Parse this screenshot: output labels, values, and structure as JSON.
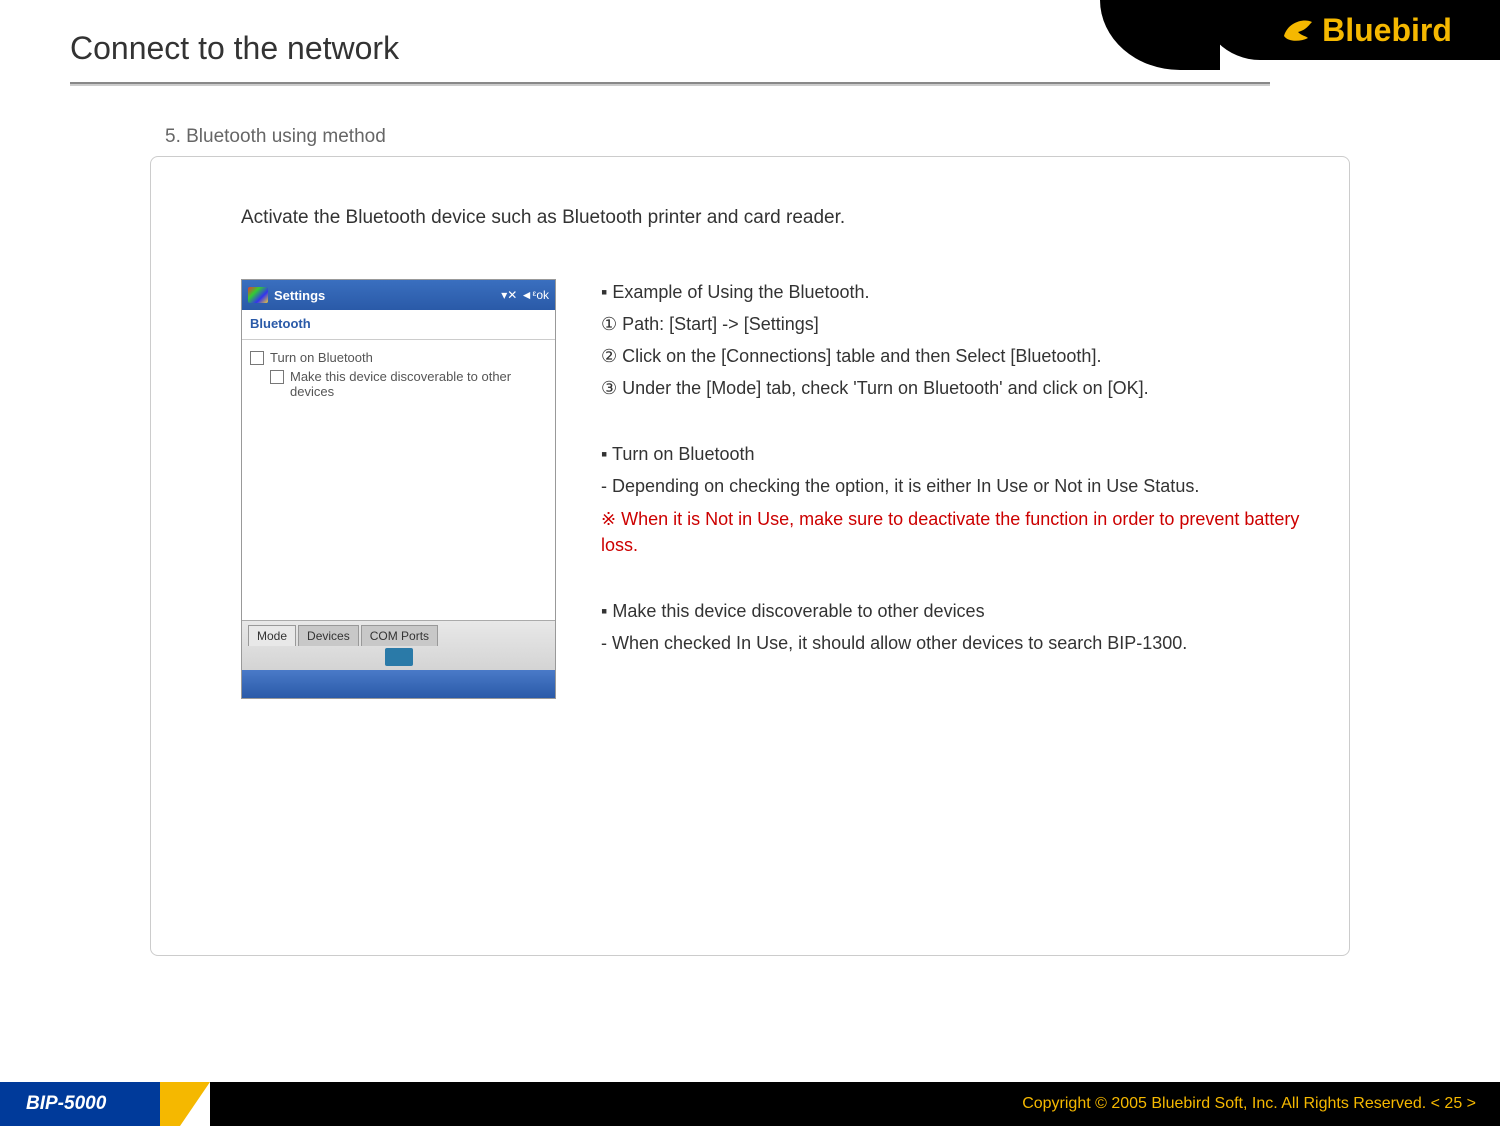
{
  "page_title": "Connect to the network",
  "brand": "Bluebird",
  "section_heading": "5. Bluetooth using method",
  "intro": "Activate the Bluetooth device such as Bluetooth printer and card reader.",
  "right": {
    "example_heading": "▪ Example of Using the Bluetooth.",
    "steps": {
      "line1": "① Path: [Start] -> [Settings]",
      "line2": "② Click on the [Connections] table and then Select [Bluetooth].",
      "line3": "③ Under the [Mode] tab, check 'Turn on Bluetooth' and click on [OK]."
    },
    "turn_on": {
      "heading": "▪ Turn on Bluetooth",
      "line1": "- Depending on checking the option, it is either In Use or Not in Use Status.",
      "warning": "※ When it is Not in Use, make sure to deactivate the function in order to prevent battery loss."
    },
    "discoverable": {
      "heading": "▪ Make this device discoverable to other devices",
      "line1": "- When checked In Use, it should allow other devices to search BIP-1300."
    }
  },
  "mock": {
    "title": "Settings",
    "status": "ok",
    "subtitle": "Bluetooth",
    "check1": "Turn on Bluetooth",
    "check2": "Make this device discoverable to other devices",
    "tabs": {
      "t1": "Mode",
      "t2": "Devices",
      "t3": "COM Ports"
    }
  },
  "footer": {
    "model": "BIP-5000",
    "copyright": "Copyright © 2005 Bluebird Soft, Inc. All Rights Reserved.   < 25 >"
  }
}
